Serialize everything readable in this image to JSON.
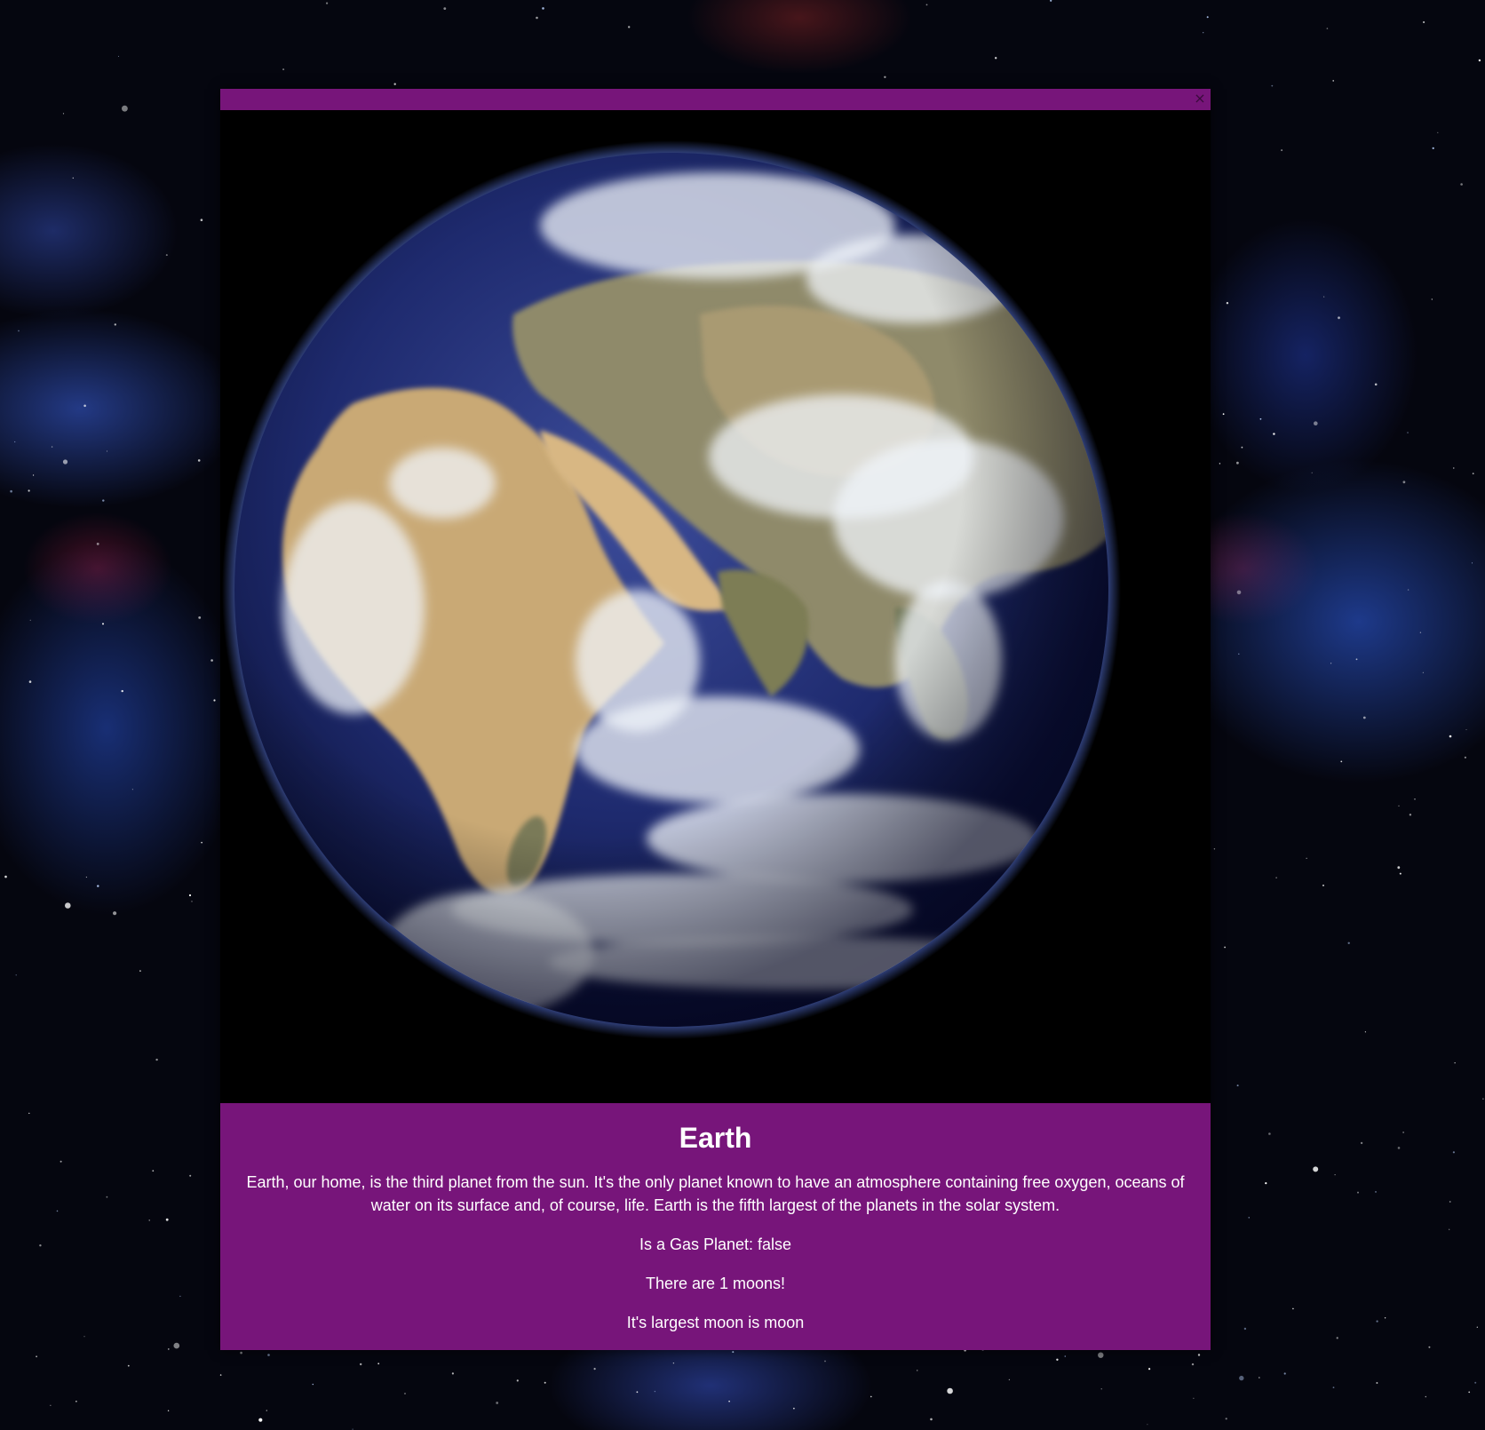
{
  "background": {
    "icon": "starfield-background"
  },
  "modal": {
    "header_color": "#77157a",
    "close_label": "×",
    "close_icon": "close-icon",
    "image_icon": "earth-globe-photo"
  },
  "planet": {
    "name": "Earth",
    "description": "Earth, our home, is the third planet from the sun. It's the only planet known to have an atmosphere containing free oxygen, oceans of water on its surface and, of course, life. Earth is the fifth largest of the planets in the solar system.",
    "gas_planet_text": "Is a Gas Planet: false",
    "moons_text": "There are 1 moons!",
    "largest_moon_text": "It's largest moon is moon"
  }
}
